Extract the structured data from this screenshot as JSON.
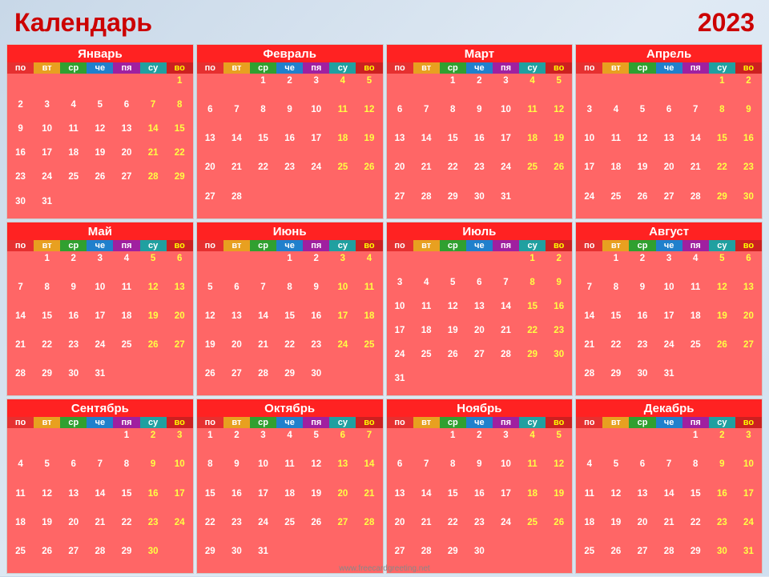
{
  "title": "Календарь",
  "year": "2023",
  "watermark": "www.freecardgreeting.net",
  "dayHeaders": [
    "по",
    "вт",
    "ср",
    "че",
    "пя",
    "су",
    "во"
  ],
  "dayHeaderClasses": [
    "mo",
    "tu",
    "we",
    "th",
    "fr",
    "sa",
    "su"
  ],
  "months": [
    {
      "name": "Январь",
      "startDay": 7,
      "days": 31
    },
    {
      "name": "Февраль",
      "startDay": 3,
      "days": 28
    },
    {
      "name": "Март",
      "startDay": 3,
      "days": 31
    },
    {
      "name": "Апрель",
      "startDay": 6,
      "days": 30
    },
    {
      "name": "Май",
      "startDay": 2,
      "days": 31
    },
    {
      "name": "Июнь",
      "startDay": 4,
      "days": 30
    },
    {
      "name": "Июль",
      "startDay": 6,
      "days": 31
    },
    {
      "name": "Август",
      "startDay": 2,
      "days": 31
    },
    {
      "name": "Сентябрь",
      "startDay": 5,
      "days": 30
    },
    {
      "name": "Октябрь",
      "startDay": 1,
      "days": 31
    },
    {
      "name": "Ноябрь",
      "startDay": 3,
      "days": 30
    },
    {
      "name": "Декабрь",
      "startDay": 5,
      "days": 31
    }
  ]
}
